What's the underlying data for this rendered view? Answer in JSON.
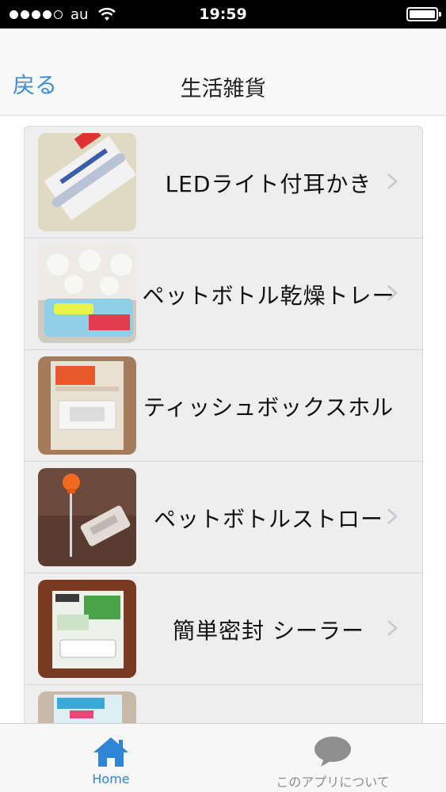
{
  "status_bar": {
    "carrier": "au",
    "time": "19:59",
    "signal_bars_filled": 4,
    "signal_bars_total": 5
  },
  "nav": {
    "back_label": "戻る",
    "title": "生活雑貨"
  },
  "items": [
    {
      "label": "LEDライト付耳かき",
      "thumb": "led-ear-pick-photo"
    },
    {
      "label": "ペットボトル乾燥トレー",
      "thumb": "bottle-drying-tray-photo"
    },
    {
      "label": "ティッシュボックスホル",
      "thumb": "tissue-box-holder-photo"
    },
    {
      "label": "ペットボトルストロー",
      "thumb": "bottle-straw-photo"
    },
    {
      "label": "簡単密封 シーラー",
      "thumb": "bag-sealer-photo"
    },
    {
      "label": "",
      "thumb": "gas-release-photo"
    }
  ],
  "tabs": {
    "home": "Home",
    "about": "このアプリについて"
  },
  "colors": {
    "accent": "#2f86d6",
    "inactive": "#8e8e8e"
  }
}
